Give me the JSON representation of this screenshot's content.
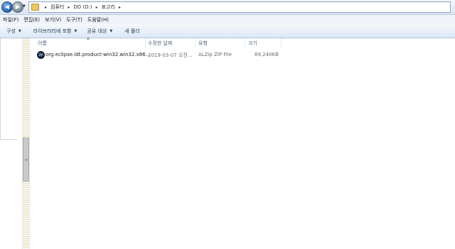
{
  "address_bar": {
    "breadcrumbs": [
      "컴퓨터",
      "DD (D:)",
      "표고리"
    ],
    "separator": "▸"
  },
  "menu": {
    "items": [
      "파일(F)",
      "편집(E)",
      "보기(V)",
      "도구(T)",
      "도움말(H)"
    ]
  },
  "toolbar": {
    "organize": "구성",
    "include_in_library": "라이브러리에 포함",
    "share_with": "공유 대상",
    "new_folder": "새 폴더"
  },
  "columns": {
    "name": "이름",
    "date_modified": "수정한 날짜",
    "type": "유형",
    "size": "크기"
  },
  "files": [
    {
      "name": "org.eclipse.ldt.product-win32.win32.x86...",
      "date_modified": "2019-03-07 오전...",
      "type": "ALZip ZIP File",
      "size": "89,240KB"
    }
  ]
}
